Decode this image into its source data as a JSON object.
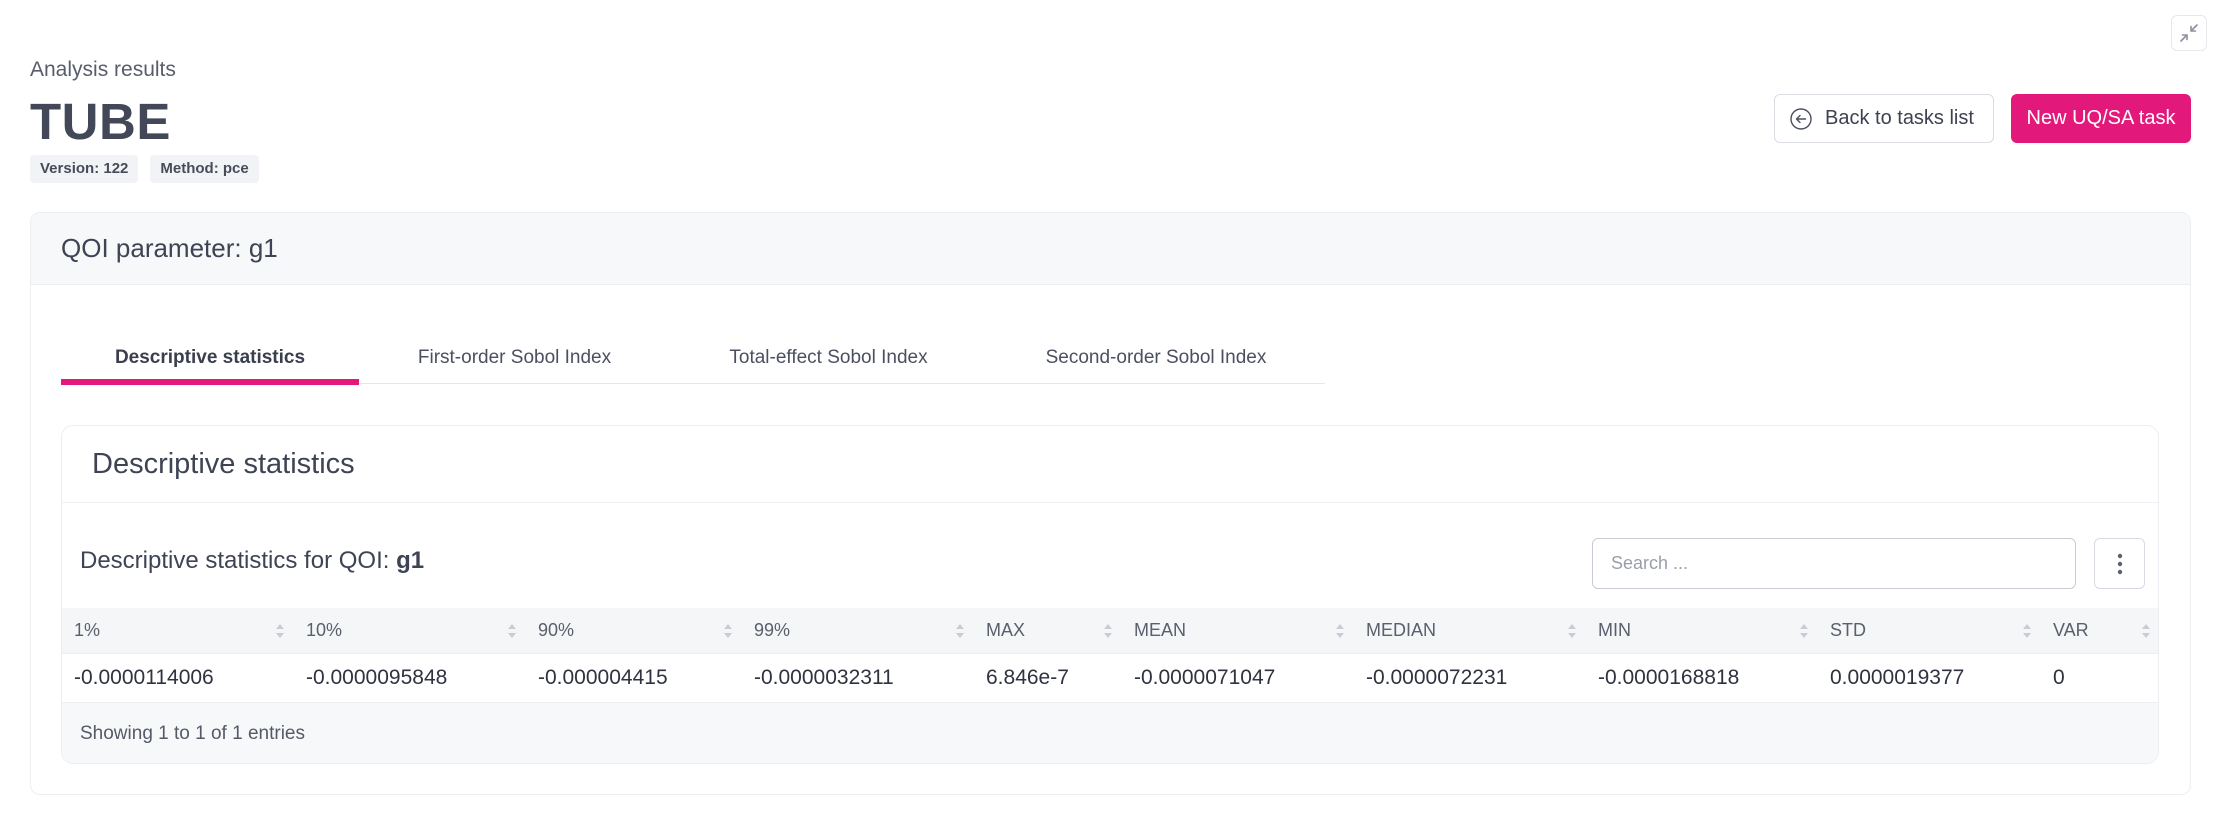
{
  "header": {
    "eyebrow": "Analysis results",
    "title": "TUBE",
    "badges": [
      {
        "label": "Version: 122"
      },
      {
        "label": "Method: pce"
      }
    ],
    "back_button": "Back to tasks list",
    "new_button": "New UQ/SA task",
    "icons": {
      "collapse": "collapse-icon",
      "back": "arrow-left-circle-icon"
    }
  },
  "card": {
    "title": "QOI parameter: g1",
    "tabs": [
      {
        "label": "Descriptive statistics",
        "active": true
      },
      {
        "label": "First-order Sobol Index",
        "active": false
      },
      {
        "label": "Total-effect Sobol Index",
        "active": false
      },
      {
        "label": "Second-order Sobol Index",
        "active": false
      }
    ]
  },
  "stats": {
    "title": "Descriptive statistics",
    "table_title_prefix": "Descriptive statistics for QOI: ",
    "qoi": "g1",
    "search_placeholder": "Search ...",
    "columns": [
      "1%",
      "10%",
      "90%",
      "99%",
      "MAX",
      "MEAN",
      "MEDIAN",
      "MIN",
      "STD",
      "VAR"
    ],
    "rows": [
      [
        "-0.0000114006",
        "-0.0000095848",
        "-0.000004415",
        "-0.0000032311",
        "6.846e-7",
        "-0.0000071047",
        "-0.0000072231",
        "-0.0000168818",
        "0.0000019377",
        "0"
      ]
    ],
    "footer": "Showing 1 to 1 of 1 entries"
  },
  "colors": {
    "accent": "#e2197b",
    "text": "#3f4454"
  }
}
